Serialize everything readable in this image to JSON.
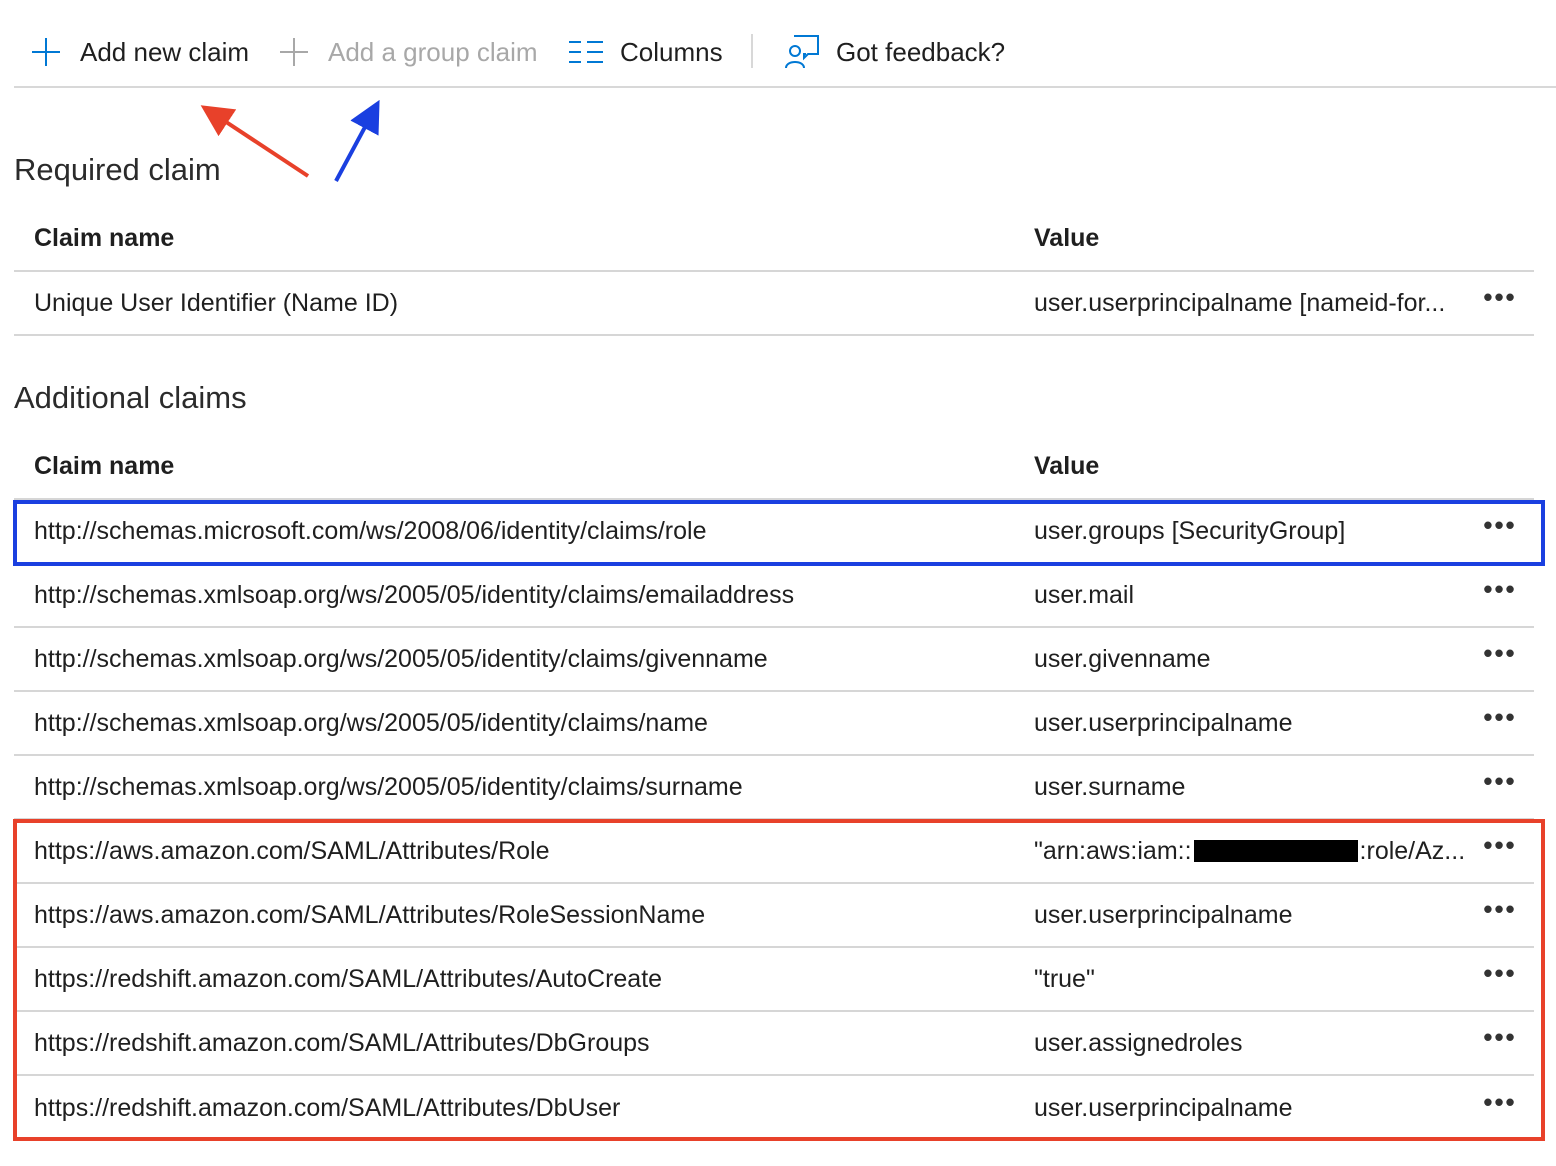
{
  "toolbar": {
    "add_new_claim": "Add new claim",
    "add_group_claim": "Add a group claim",
    "columns": "Columns",
    "feedback": "Got feedback?"
  },
  "required": {
    "title": "Required claim",
    "col_name": "Claim name",
    "col_value": "Value",
    "rows": [
      {
        "name": "Unique User Identifier (Name ID)",
        "value": "user.userprincipalname [nameid-for..."
      }
    ]
  },
  "additional": {
    "title": "Additional claims",
    "col_name": "Claim name",
    "col_value": "Value",
    "rows": [
      {
        "name": "http://schemas.microsoft.com/ws/2008/06/identity/claims/role",
        "value": "user.groups [SecurityGroup]"
      },
      {
        "name": "http://schemas.xmlsoap.org/ws/2005/05/identity/claims/emailaddress",
        "value": "user.mail"
      },
      {
        "name": "http://schemas.xmlsoap.org/ws/2005/05/identity/claims/givenname",
        "value": "user.givenname"
      },
      {
        "name": "http://schemas.xmlsoap.org/ws/2005/05/identity/claims/name",
        "value": "user.userprincipalname"
      },
      {
        "name": "http://schemas.xmlsoap.org/ws/2005/05/identity/claims/surname",
        "value": "user.surname"
      },
      {
        "name": "https://aws.amazon.com/SAML/Attributes/Role",
        "value_prefix": "\"arn:aws:iam::",
        "value_suffix": ":role/Az..."
      },
      {
        "name": "https://aws.amazon.com/SAML/Attributes/RoleSessionName",
        "value": "user.userprincipalname"
      },
      {
        "name": "https://redshift.amazon.com/SAML/Attributes/AutoCreate",
        "value": "\"true\""
      },
      {
        "name": "https://redshift.amazon.com/SAML/Attributes/DbGroups",
        "value": "user.assignedroles"
      },
      {
        "name": "https://redshift.amazon.com/SAML/Attributes/DbUser",
        "value": "user.userprincipalname"
      }
    ]
  },
  "more_label": "•••",
  "icons": {
    "add": "plus-icon",
    "add_group": "plus-icon",
    "columns": "columns-icon",
    "feedback": "feedback-icon",
    "more": "more-icon"
  },
  "colors": {
    "accent": "#0078d4",
    "highlight_blue": "#1a3fe0",
    "highlight_red": "#e8412a",
    "disabled_text": "#a8a8a8"
  }
}
